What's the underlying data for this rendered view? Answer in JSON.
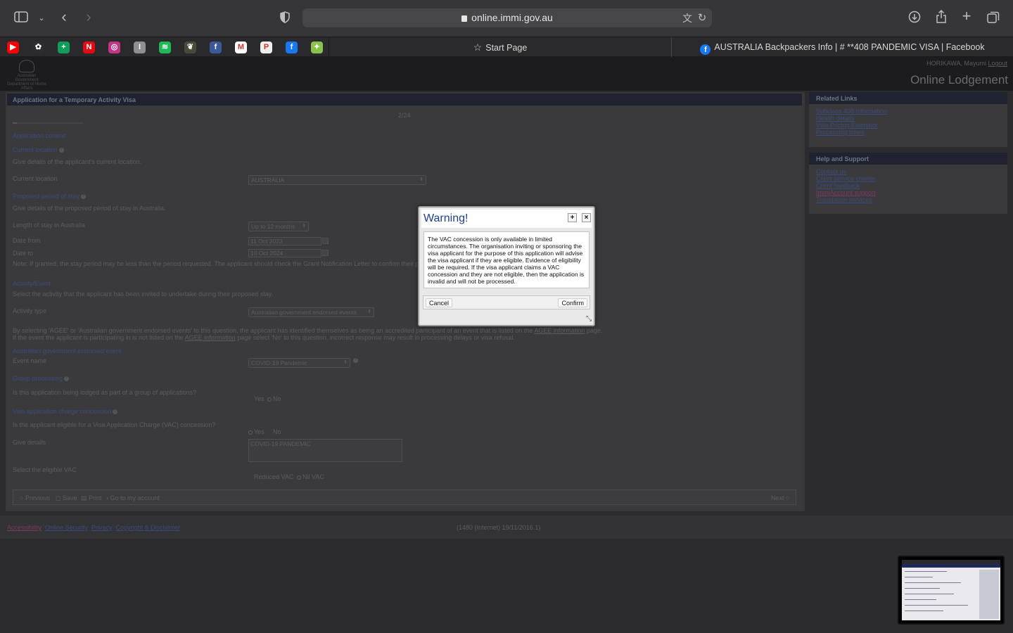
{
  "browser": {
    "url": "online.immi.gov.au",
    "tabs": [
      {
        "label": "Start Page"
      },
      {
        "label": "AUSTRALIA Backpackers Info | # **408 PANDEMIC VISA | Facebook"
      }
    ],
    "favorites": [
      {
        "icon": "youtube-icon",
        "color": "#ff0000",
        "glyph": "▶"
      },
      {
        "icon": "photos-icon",
        "color": "#2d2d30",
        "glyph": "✿"
      },
      {
        "icon": "sheets-icon",
        "color": "#0f9d58",
        "glyph": "+"
      },
      {
        "icon": "netflix-icon",
        "color": "#e50914",
        "glyph": "N"
      },
      {
        "icon": "instagram-icon",
        "color": "#c13584",
        "glyph": "◎"
      },
      {
        "icon": "app-icon",
        "color": "#8e8e93",
        "glyph": "I"
      },
      {
        "icon": "spotify-icon",
        "color": "#1db954",
        "glyph": "≋"
      },
      {
        "icon": "bird-icon",
        "color": "#4a4a3a",
        "glyph": "❦"
      },
      {
        "icon": "facebook-square-icon",
        "color": "#3b5998",
        "glyph": "f"
      },
      {
        "icon": "gmail-icon",
        "color": "#ffffff",
        "glyph": "M"
      },
      {
        "icon": "pwc-icon",
        "color": "#eeeeee",
        "glyph": "P"
      },
      {
        "icon": "facebook-icon",
        "color": "#1877f2",
        "glyph": "f"
      },
      {
        "icon": "green-app-icon",
        "color": "#8bc34a",
        "glyph": "✦"
      }
    ]
  },
  "site": {
    "crest_text": "Australian Government Department of Home Affairs",
    "user_name": "HORIKAWA, Mayumi",
    "logout": "Logout",
    "title": "Online Lodgement"
  },
  "form": {
    "panel_title": "Application for a Temporary Activity Visa",
    "page_counter": "2/24",
    "application_context": "Application context",
    "current_location_heading": "Current location",
    "current_location_desc": "Give details of the applicant's current location.",
    "current_location_label": "Current location",
    "current_location_value": "AUSTRALIA",
    "stay_heading": "Proposed period of stay",
    "stay_desc": "Give details of the proposed period of stay in Australia.",
    "length_label": "Length of stay in Australia",
    "length_value": "Up to 12 months",
    "date_from_label": "Date from",
    "date_from_value": "11 Oct 2023",
    "date_to_label": "Date to",
    "date_to_value": "10 Oct 2024",
    "stay_note": "Note: If granted, the stay period may be less than the period requested. The applicant should check the Grant Notification Letter to confirm their p",
    "activity_heading": "Activity/Event",
    "activity_desc": "Select the activity that the applicant has been invited to undertake during their proposed stay.",
    "activity_type_label": "Activity type",
    "activity_type_value": "Australian government endorsed events",
    "agee_line1_a": "By selecting 'AGEE' or 'Australian government endorsed events' to this question, the applicant has identified themselves as being an accredited participant of an event that is listed on the",
    "agee_link": "AGEE information",
    "agee_line1_b": "page.",
    "agee_line2_a": "If the event the applicant is participating in is not listed on the",
    "agee_line2_b": "page select 'No' to this question, incorrect response may result in processing delays or visa refusal.",
    "agee_event_heading": "Australian government endorsed event",
    "event_name_label": "Event name",
    "event_name_value": "COVID-19 Pandemic",
    "group_heading": "Group processing",
    "group_question": "Is this application being lodged as part of a group of applications?",
    "yes": "Yes",
    "no": "No",
    "vac_heading": "Visa application charge concession",
    "vac_question": "Is the applicant eligible for a Visa Application Charge (VAC) concession?",
    "give_details_label": "Give details",
    "give_details_value": "COVID-19 PANDEMIC",
    "eligible_vac_label": "Select the eligible VAC",
    "reduced_vac": "Reduced VAC",
    "nil_vac": "Nil VAC",
    "nav": {
      "previous": "Previous",
      "save": "Save",
      "print": "Print",
      "account": "Go to my account",
      "next": "Next"
    }
  },
  "sidebar": {
    "related_title": "Related Links",
    "related_links": [
      "Subclass 408 information",
      "Health details",
      "Visa Pricing Estimator",
      "Processing times"
    ],
    "help_title": "Help and Support",
    "help_links": [
      "Contact us",
      "Client service charter",
      "Client feedback",
      "ImmiAccount support",
      "Translation services"
    ]
  },
  "footer": {
    "links": [
      "Accessibility",
      "Online Security",
      "Privacy",
      "Copyright & Disclaimer"
    ],
    "build": "(1480 (Internet) 19/11/2016.1)"
  },
  "modal": {
    "title": "Warning!",
    "body": "The VAC concession is only available in limited circumstances. The organisation inviting or sponsoring the visa applicant for the purpose of this application will advise the visa applicant if they are eligible. Evidence of eligibility will be required. If the visa applicant claims a VAC concession and they are not eligible, then the application is invalid and will not be processed.",
    "cancel": "Cancel",
    "confirm": "Confirm"
  }
}
